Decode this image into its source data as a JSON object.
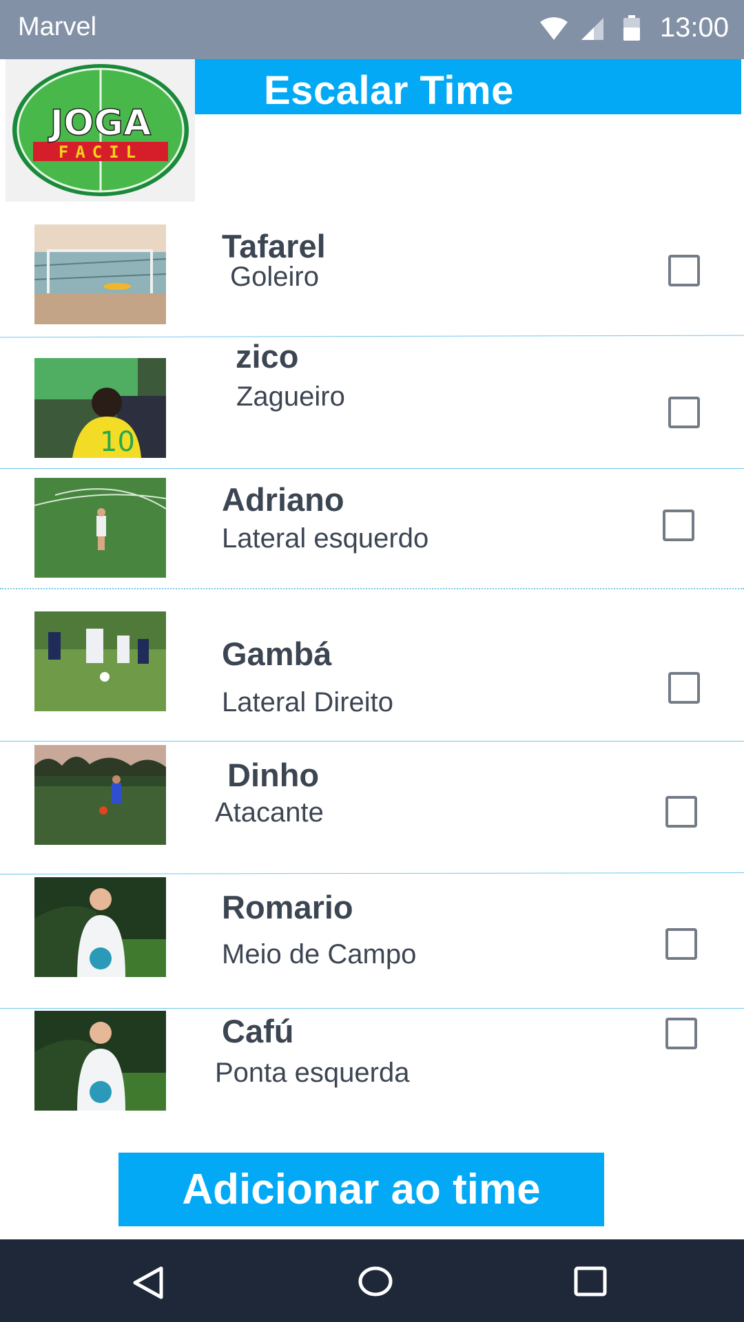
{
  "status_bar": {
    "app_name": "Marvel",
    "time": "13:00"
  },
  "header": {
    "logo_text_top": "JOGA",
    "logo_text_bottom": "FACIL",
    "title": "Escalar Time"
  },
  "players": [
    {
      "name": "Tafarel",
      "role": "Goleiro"
    },
    {
      "name": "zico",
      "role": "Zagueiro"
    },
    {
      "name": "Adriano",
      "role": "Lateral esquerdo"
    },
    {
      "name": "Gambá",
      "role": "Lateral Direito"
    },
    {
      "name": "Dinho",
      "role": "Atacante"
    },
    {
      "name": "Romario",
      "role": "Meio de Campo"
    },
    {
      "name": "Cafú",
      "role": "Ponta esquerda"
    }
  ],
  "add_button": {
    "label": "Adicionar ao time"
  },
  "colors": {
    "accent": "#03a9f4",
    "status_bar": "#8391a7",
    "nav_bar": "#1e2838",
    "text": "#3c4552"
  },
  "icons": {
    "status": [
      "wifi-icon",
      "signal-icon",
      "battery-icon"
    ],
    "nav": [
      "back-icon",
      "home-icon",
      "recents-icon"
    ]
  }
}
